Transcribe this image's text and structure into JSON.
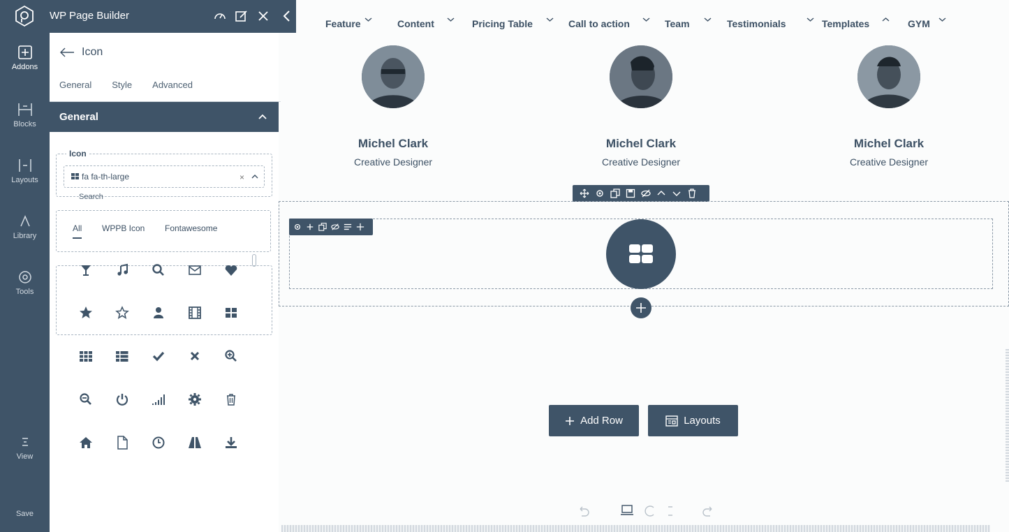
{
  "rail": {
    "items": [
      {
        "label": "Addons",
        "icon": "plus-square-icon",
        "active": true
      },
      {
        "label": "Blocks",
        "icon": "blocks-icon"
      },
      {
        "label": "Layouts",
        "icon": "layout-icon"
      },
      {
        "label": "Library",
        "icon": "library-icon"
      },
      {
        "label": "Tools",
        "icon": "tools-icon"
      },
      {
        "label": "View",
        "icon": "view-icon"
      },
      {
        "label": "Save",
        "icon": "save-icon"
      }
    ]
  },
  "panel": {
    "app_title": "WP Page Builder",
    "addon_title": "Icon",
    "tabs": [
      "General",
      "Style",
      "Advanced"
    ],
    "section_title": "General",
    "icon_field": {
      "label": "Icon",
      "value": "fa fa-th-large",
      "search_placeholder": "Search"
    },
    "filters": [
      "All",
      "WPPB Icon",
      "Fontawesome"
    ],
    "icons": [
      "glass-icon",
      "music-icon",
      "search-icon",
      "envelope-icon",
      "heart-icon",
      "star-icon",
      "star-outline-icon",
      "user-icon",
      "film-icon",
      "th-large-icon",
      "th-icon",
      "th-list-icon",
      "check-icon",
      "close-icon",
      "zoom-in-icon",
      "zoom-out-icon",
      "power-icon",
      "signal-icon",
      "cog-icon",
      "trash-icon",
      "home-icon",
      "file-icon",
      "clock-icon",
      "road-icon",
      "download-icon"
    ]
  },
  "nav": {
    "items": [
      "Feature",
      "Content",
      "Pricing Table",
      "Call to action",
      "Team",
      "Testimonials",
      "Templates",
      "GYM"
    ]
  },
  "team": [
    {
      "name": "Michel Clark",
      "role": "Creative Designer"
    },
    {
      "name": "Michel Clark",
      "role": "Creative Designer"
    },
    {
      "name": "Michel Clark",
      "role": "Creative Designer"
    }
  ],
  "actions": {
    "add_row": "Add Row",
    "layouts": "Layouts"
  },
  "colors": {
    "primary": "#3f5468",
    "background": "#fbfcfc",
    "text": "#3c5064"
  }
}
